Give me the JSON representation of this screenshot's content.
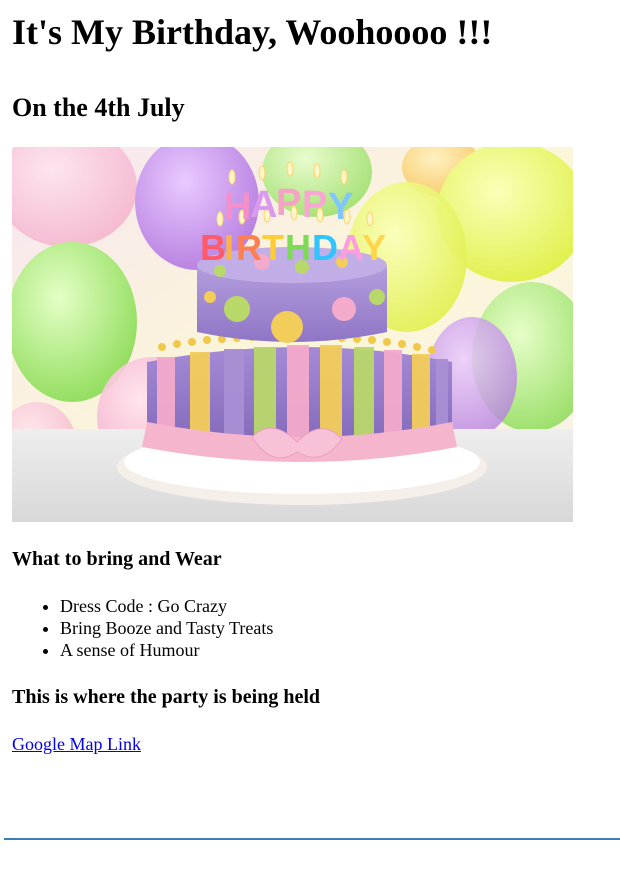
{
  "page": {
    "title": "It's My Birthday, Woohoooo !!!",
    "subtitle": "On the 4th July"
  },
  "hero_image": {
    "alt": "Birthday cake with HAPPY BIRTHDAY candles",
    "candle_top_text": "HAPPY",
    "candle_bottom_text": "BIRTHDAY",
    "colors": {
      "cake_top": "#a98fd4",
      "cake_stripe_yellow": "#f2cd5a",
      "cake_stripe_green": "#b8d86a",
      "cake_stripe_pink": "#f4aacb",
      "ribbon": "#f5b5cc",
      "balloon_yellow": "#e6f35a",
      "balloon_green": "#9ee66e",
      "balloon_purple": "#c58ee8",
      "balloon_pink": "#f6b7d2"
    }
  },
  "bring_section": {
    "heading": "What to bring and Wear",
    "items": [
      "Dress Code : Go Crazy",
      "Bring Booze and Tasty Treats",
      "A sense of Humour"
    ]
  },
  "location_section": {
    "heading": "This is where the party is being held",
    "map_link_label": "Google Map Link"
  },
  "colors": {
    "link": "#0000ee",
    "bottom_rule": "#3a7fb5"
  }
}
